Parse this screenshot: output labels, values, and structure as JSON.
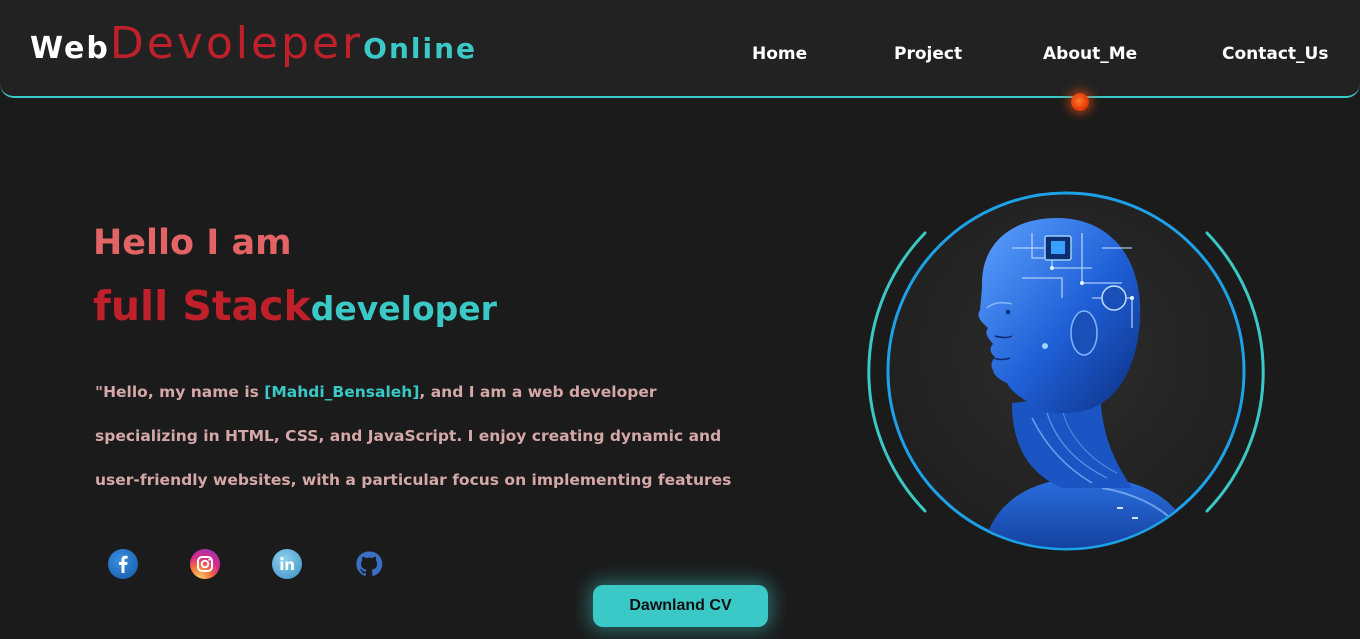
{
  "header": {
    "logo": {
      "part1": "Web",
      "part2": "Devoleper",
      "part3": "Online"
    },
    "nav": [
      {
        "label": "Home"
      },
      {
        "label": "Project"
      },
      {
        "label": "About_Me"
      },
      {
        "label": "Contact_Us"
      }
    ]
  },
  "hero": {
    "greeting": "Hello I am",
    "role_part1": "full Stack",
    "role_part2": "developer",
    "desc_prefix": "\"Hello, my name is ",
    "desc_name": "[Mahdi_Bensaleh]",
    "desc_suffix": ", and I am a web developer specializing in HTML, CSS, and JavaScript. I enjoy creating dynamic and user-friendly websites, with a particular focus on implementing features",
    "cv_button": "Dawnland CV"
  },
  "social": [
    {
      "icon": "facebook-icon"
    },
    {
      "icon": "instagram-icon"
    },
    {
      "icon": "linkedin-icon"
    },
    {
      "icon": "github-icon"
    }
  ],
  "colors": {
    "background": "#1b1b1b",
    "header": "#222222",
    "accent_teal": "#3ac9c6",
    "accent_red": "#c0202a",
    "greeting_pink": "#e26465",
    "ring_blue": "#1da1e8"
  }
}
